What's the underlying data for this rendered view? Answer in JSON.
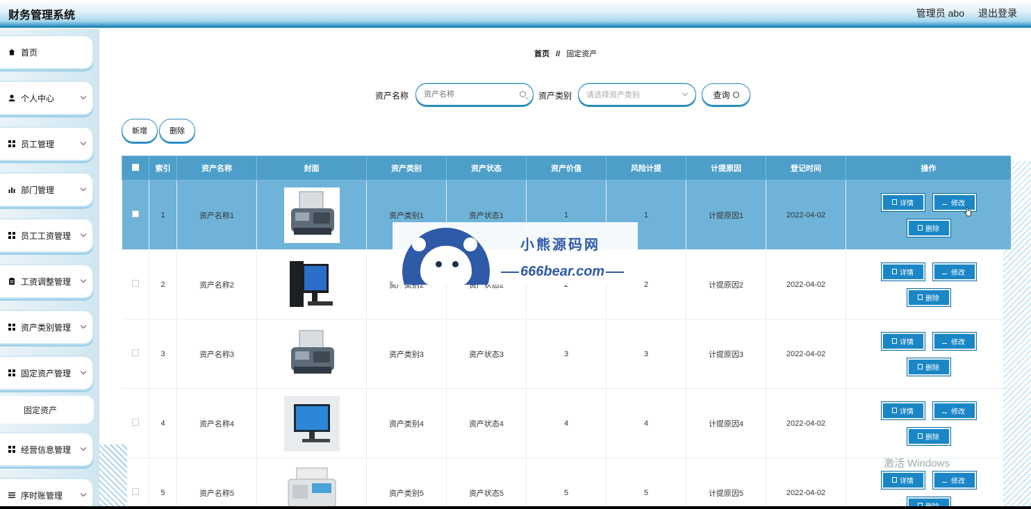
{
  "header": {
    "title": "财务管理系统",
    "user": "管理员 abo",
    "logout": "退出登录"
  },
  "sidebar": {
    "items": [
      {
        "label": "首页",
        "icon": "home-icon",
        "has_children": false
      },
      {
        "label": "个人中心",
        "icon": "user-icon",
        "has_children": true
      },
      {
        "label": "员工管理",
        "icon": "grid-icon",
        "has_children": true
      },
      {
        "label": "部门管理",
        "icon": "bar-chart-icon",
        "has_children": true
      },
      {
        "label": "员工工资管理",
        "icon": "grid-icon",
        "has_children": true
      },
      {
        "label": "工资调整管理",
        "icon": "clipboard-icon",
        "has_children": true
      },
      {
        "label": "资产类别管理",
        "icon": "grid-icon",
        "has_children": true
      },
      {
        "label": "固定资产管理",
        "icon": "grid-icon",
        "has_children": true
      }
    ],
    "sub_item": "固定资产",
    "items_after": [
      {
        "label": "经营信息管理",
        "icon": "grid-icon",
        "has_children": true
      },
      {
        "label": "序时账管理",
        "icon": "list-icon",
        "has_children": true
      }
    ]
  },
  "breadcrumb": {
    "home": "首页",
    "separator": "//",
    "current": "固定资产"
  },
  "search": {
    "name_label": "资产名称",
    "name_placeholder": "资产名称",
    "category_label": "资产类别",
    "category_placeholder": "请选择资产类别",
    "query_label": "查询"
  },
  "actions": {
    "add": "新增",
    "delete": "删除"
  },
  "table": {
    "headers": [
      "",
      "索引",
      "资产名称",
      "封面",
      "资产类别",
      "资产状态",
      "资产价值",
      "风险计提",
      "计提原因",
      "登记时间",
      "操作"
    ],
    "rows": [
      {
        "index": "1",
        "name": "资产名称1",
        "cover": "fax-machine",
        "category": "资产类别1",
        "status": "资产状态1",
        "value": "1",
        "risk": "1",
        "reason": "计提原因1",
        "date": "2022-04-02"
      },
      {
        "index": "2",
        "name": "资产名称2",
        "cover": "desktop-computer",
        "category": "资产类别2",
        "status": "资产状态2",
        "value": "2",
        "risk": "2",
        "reason": "计提原因2",
        "date": "2022-04-02"
      },
      {
        "index": "3",
        "name": "资产名称3",
        "cover": "fax-machine",
        "category": "资产类别3",
        "status": "资产状态3",
        "value": "3",
        "risk": "3",
        "reason": "计提原因3",
        "date": "2022-04-02"
      },
      {
        "index": "4",
        "name": "资产名称4",
        "cover": "monitor-display",
        "category": "资产类别4",
        "status": "资产状态4",
        "value": "4",
        "risk": "4",
        "reason": "计提原因4",
        "date": "2022-04-02"
      },
      {
        "index": "5",
        "name": "资产名称5",
        "cover": "printer",
        "category": "资产类别5",
        "status": "资产状态5",
        "value": "5",
        "risk": "5",
        "reason": "计提原因5",
        "date": "2022-04-02"
      }
    ],
    "op_labels": {
      "detail": "详情",
      "edit": "修改",
      "delete": "删除"
    }
  },
  "watermark": {
    "title": "小熊源码网",
    "url": "666bear.com"
  },
  "os_overlay": {
    "activate": "激活 Windows"
  },
  "colors": {
    "accent": "#1a86c5",
    "header_row": "#4d9fc9",
    "active_row": "#6fb3d8",
    "brand_blue": "#2f5aa8"
  }
}
